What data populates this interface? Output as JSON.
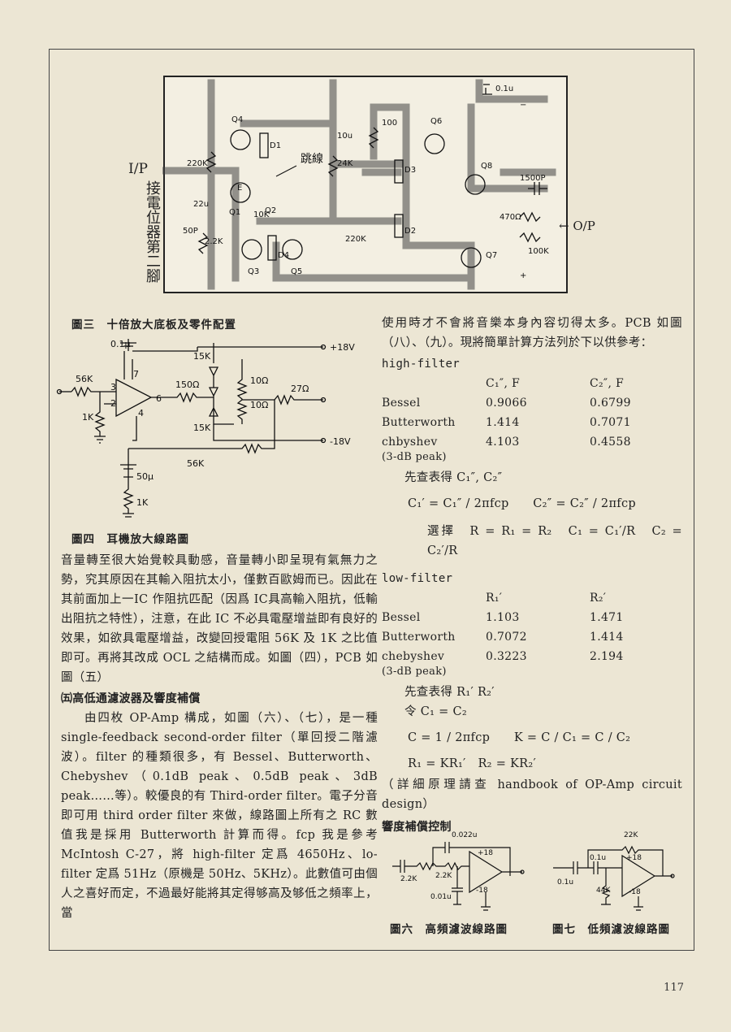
{
  "figure3": {
    "input_label": "I/P",
    "vertical_label": "接電位器第二腳",
    "jumper_label": "跳線",
    "caption": "圖三　十倍放大底板及零件配置",
    "parts": [
      "Q4",
      "Q2",
      "Q1",
      "Q3",
      "Q5",
      "Q6",
      "Q8",
      "Q7",
      "D1",
      "D2",
      "D3",
      "D4",
      "220K",
      "2.2K",
      "50P",
      "10K",
      "24K",
      "220K",
      "100",
      "10u",
      "0.1u",
      "1500P",
      "470Ω",
      "100K",
      "O/P",
      "22u"
    ]
  },
  "figure4": {
    "caption": "圖四　耳機放大線路圖",
    "labels": {
      "c1": "0.1μ",
      "v_pos": "+18V",
      "v_neg": "-18V",
      "r_in": "56K",
      "r_gnd": "1K",
      "r_fb": "56K",
      "r_bias_top": "15K",
      "r_bias_bot": "15K",
      "r_out1": "150Ω",
      "r_e1": "10Ω",
      "r_e2": "10Ω",
      "r_load": "27Ω",
      "c_fb": "50μ",
      "r_fb_gnd": "1K",
      "pin3": "3",
      "pin2": "2",
      "pin7": "7",
      "pin6": "6",
      "pin4": "4"
    }
  },
  "left_column": {
    "para1": "音量轉至很大始覺較具動感，音量轉小即呈現有氣無力之勢，究其原因在其輸入阻抗太小，僅數百歐姆而已。因此在其前面加上一IC 作阻抗匹配（因爲 IC具高輸入阻抗，低輸出阻抗之特性），注意，在此 IC 不必具電壓增益即有良好的效果，如欲具電壓增益，改變回授電阻 56K 及 1K 之比值即可。再將其改成 OCL 之結構而成。如圖（四），PCB 如圖（五）",
    "heading5": "㈤高低通濾波器及響度補償",
    "para2": "由四枚 OP-Amp 構成，如圖（六）、（七），是一種 single-feedback second-order filter（單回授二階濾波）。filter 的種類很多，有 Bessel、Butterworth、Chebyshev（0.1dB peak、0.5dB peak、3dB peak……等）。較優良的有 Third-order filter。電子分音即可用 third order filter 來做，線路圖上所有之 RC 數值我是採用 Butterworth 計算而得。fcp 我是參考 McIntosh C-27，將 high-filter 定爲 4650Hz、lo-filter 定爲 51Hz（原機是 50Hz、5KHz）。此數值可由個人之喜好而定，不過最好能將其定得够高及够低之頻率上，當"
  },
  "right_column": {
    "intro": "使用時才不會將音樂本身內容切得太多。PCB 如圖（八）、（九）。現將簡單計算方法列於下以供參考：",
    "high_filter": {
      "title": "high-filter",
      "headers": [
        "",
        "C₁″, F",
        "C₂″, F"
      ],
      "rows": [
        [
          "Bessel",
          "0.9066",
          "0.6799"
        ],
        [
          "Butterworth",
          "1.414",
          "0.7071"
        ],
        [
          "chbyshev",
          "4.103",
          "0.4558"
        ]
      ],
      "note": "(3-dB peak)",
      "lookup": "先查表得 C₁″, C₂″",
      "formula1": "C₁′ = C₁″ / 2πfcp　　C₂″ = C₂″ / 2πfcp",
      "formula2": "選擇　R = R₁ = R₂　C₁ = C₁′/R　C₂ = C₂′/R"
    },
    "low_filter": {
      "title": "low-filter",
      "headers": [
        "",
        "R₁′",
        "R₂′"
      ],
      "rows": [
        [
          "Bessel",
          "1.103",
          "1.471"
        ],
        [
          "Butterworth",
          "0.7072",
          "1.414"
        ],
        [
          "chebyshev",
          "0.3223",
          "2.194"
        ]
      ],
      "note": "(3-dB peak)",
      "lookup": "先查表得 R₁′ R₂′",
      "let": "令 C₁ = C₂",
      "formula1": "C = 1 / 2πfcp　　K = C / C₁ = C / C₂",
      "formula2": "R₁ = KR₁′　R₂ = KR₂′"
    },
    "reference": "（詳細原理請查 handbook of OP-Amp circuit design）",
    "heading_loudness": "響度補償控制"
  },
  "figure6": {
    "caption": "圖六　高頻濾波線路圖",
    "labels": [
      "0.022u",
      "2.2K",
      "2.2K",
      "0.01u",
      "+18",
      "-18"
    ]
  },
  "figure7": {
    "caption": "圖七　低頻濾波線路圖",
    "labels": [
      "22K",
      "0.1u",
      "0.1u",
      "44K",
      "+18",
      "-18"
    ]
  },
  "page_number": "117"
}
